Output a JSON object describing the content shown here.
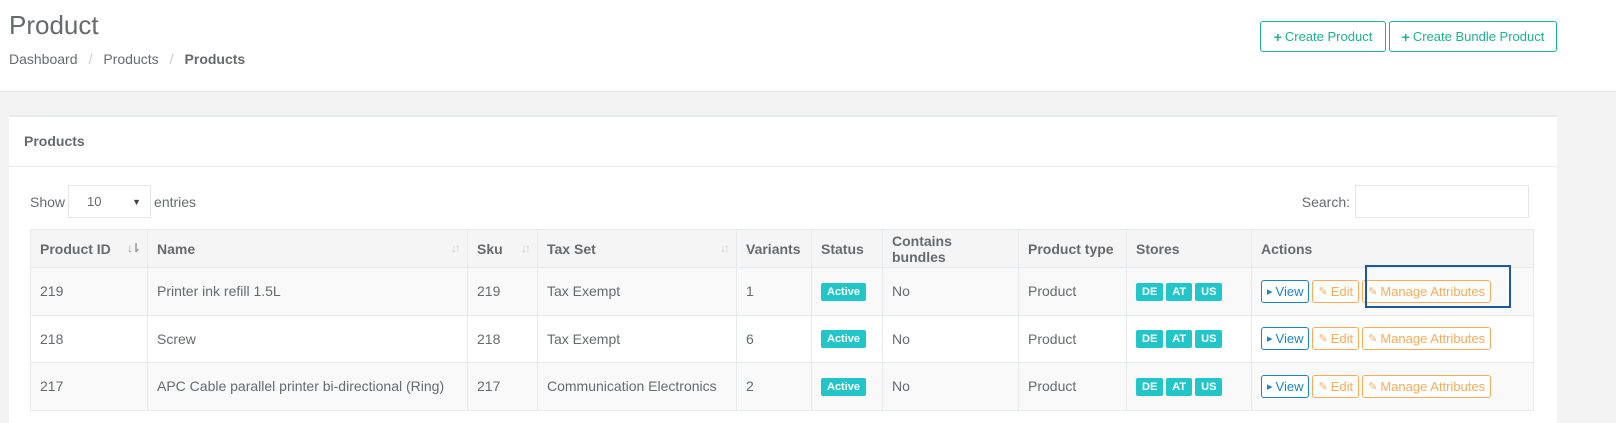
{
  "header": {
    "title": "Product",
    "breadcrumb": [
      "Dashboard",
      "Products",
      "Products"
    ],
    "create_product_label": "Create Product",
    "create_bundle_label": "Create Bundle Product"
  },
  "panel": {
    "title": "Products",
    "show_label": "Show",
    "entries_label": "entries",
    "page_size": "10",
    "search_label": "Search:",
    "search_value": ""
  },
  "table": {
    "columns": [
      "Product ID",
      "Name",
      "Sku",
      "Tax Set",
      "Variants",
      "Status",
      "Contains bundles",
      "Product type",
      "Stores",
      "Actions"
    ],
    "rows": [
      {
        "id": "219",
        "name": "Printer ink refill 1.5L",
        "sku": "219",
        "tax_set": "Tax Exempt",
        "variants": "1",
        "status": "Active",
        "bundles": "No",
        "type": "Product",
        "stores": [
          "DE",
          "AT",
          "US"
        ]
      },
      {
        "id": "218",
        "name": "Screw",
        "sku": "218",
        "tax_set": "Tax Exempt",
        "variants": "6",
        "status": "Active",
        "bundles": "No",
        "type": "Product",
        "stores": [
          "DE",
          "AT",
          "US"
        ]
      },
      {
        "id": "217",
        "name": "APC Cable parallel printer bi-directional (Ring)",
        "sku": "217",
        "tax_set": "Communication Electronics",
        "variants": "2",
        "status": "Active",
        "bundles": "No",
        "type": "Product",
        "stores": [
          "DE",
          "AT",
          "US"
        ]
      }
    ],
    "actions": {
      "view": "View",
      "edit": "Edit",
      "manage": "Manage Attributes"
    }
  },
  "colors": {
    "primary": "#1ab394",
    "info": "#23c6c8",
    "view": "#1c84c6",
    "warning": "#f8ac59"
  }
}
